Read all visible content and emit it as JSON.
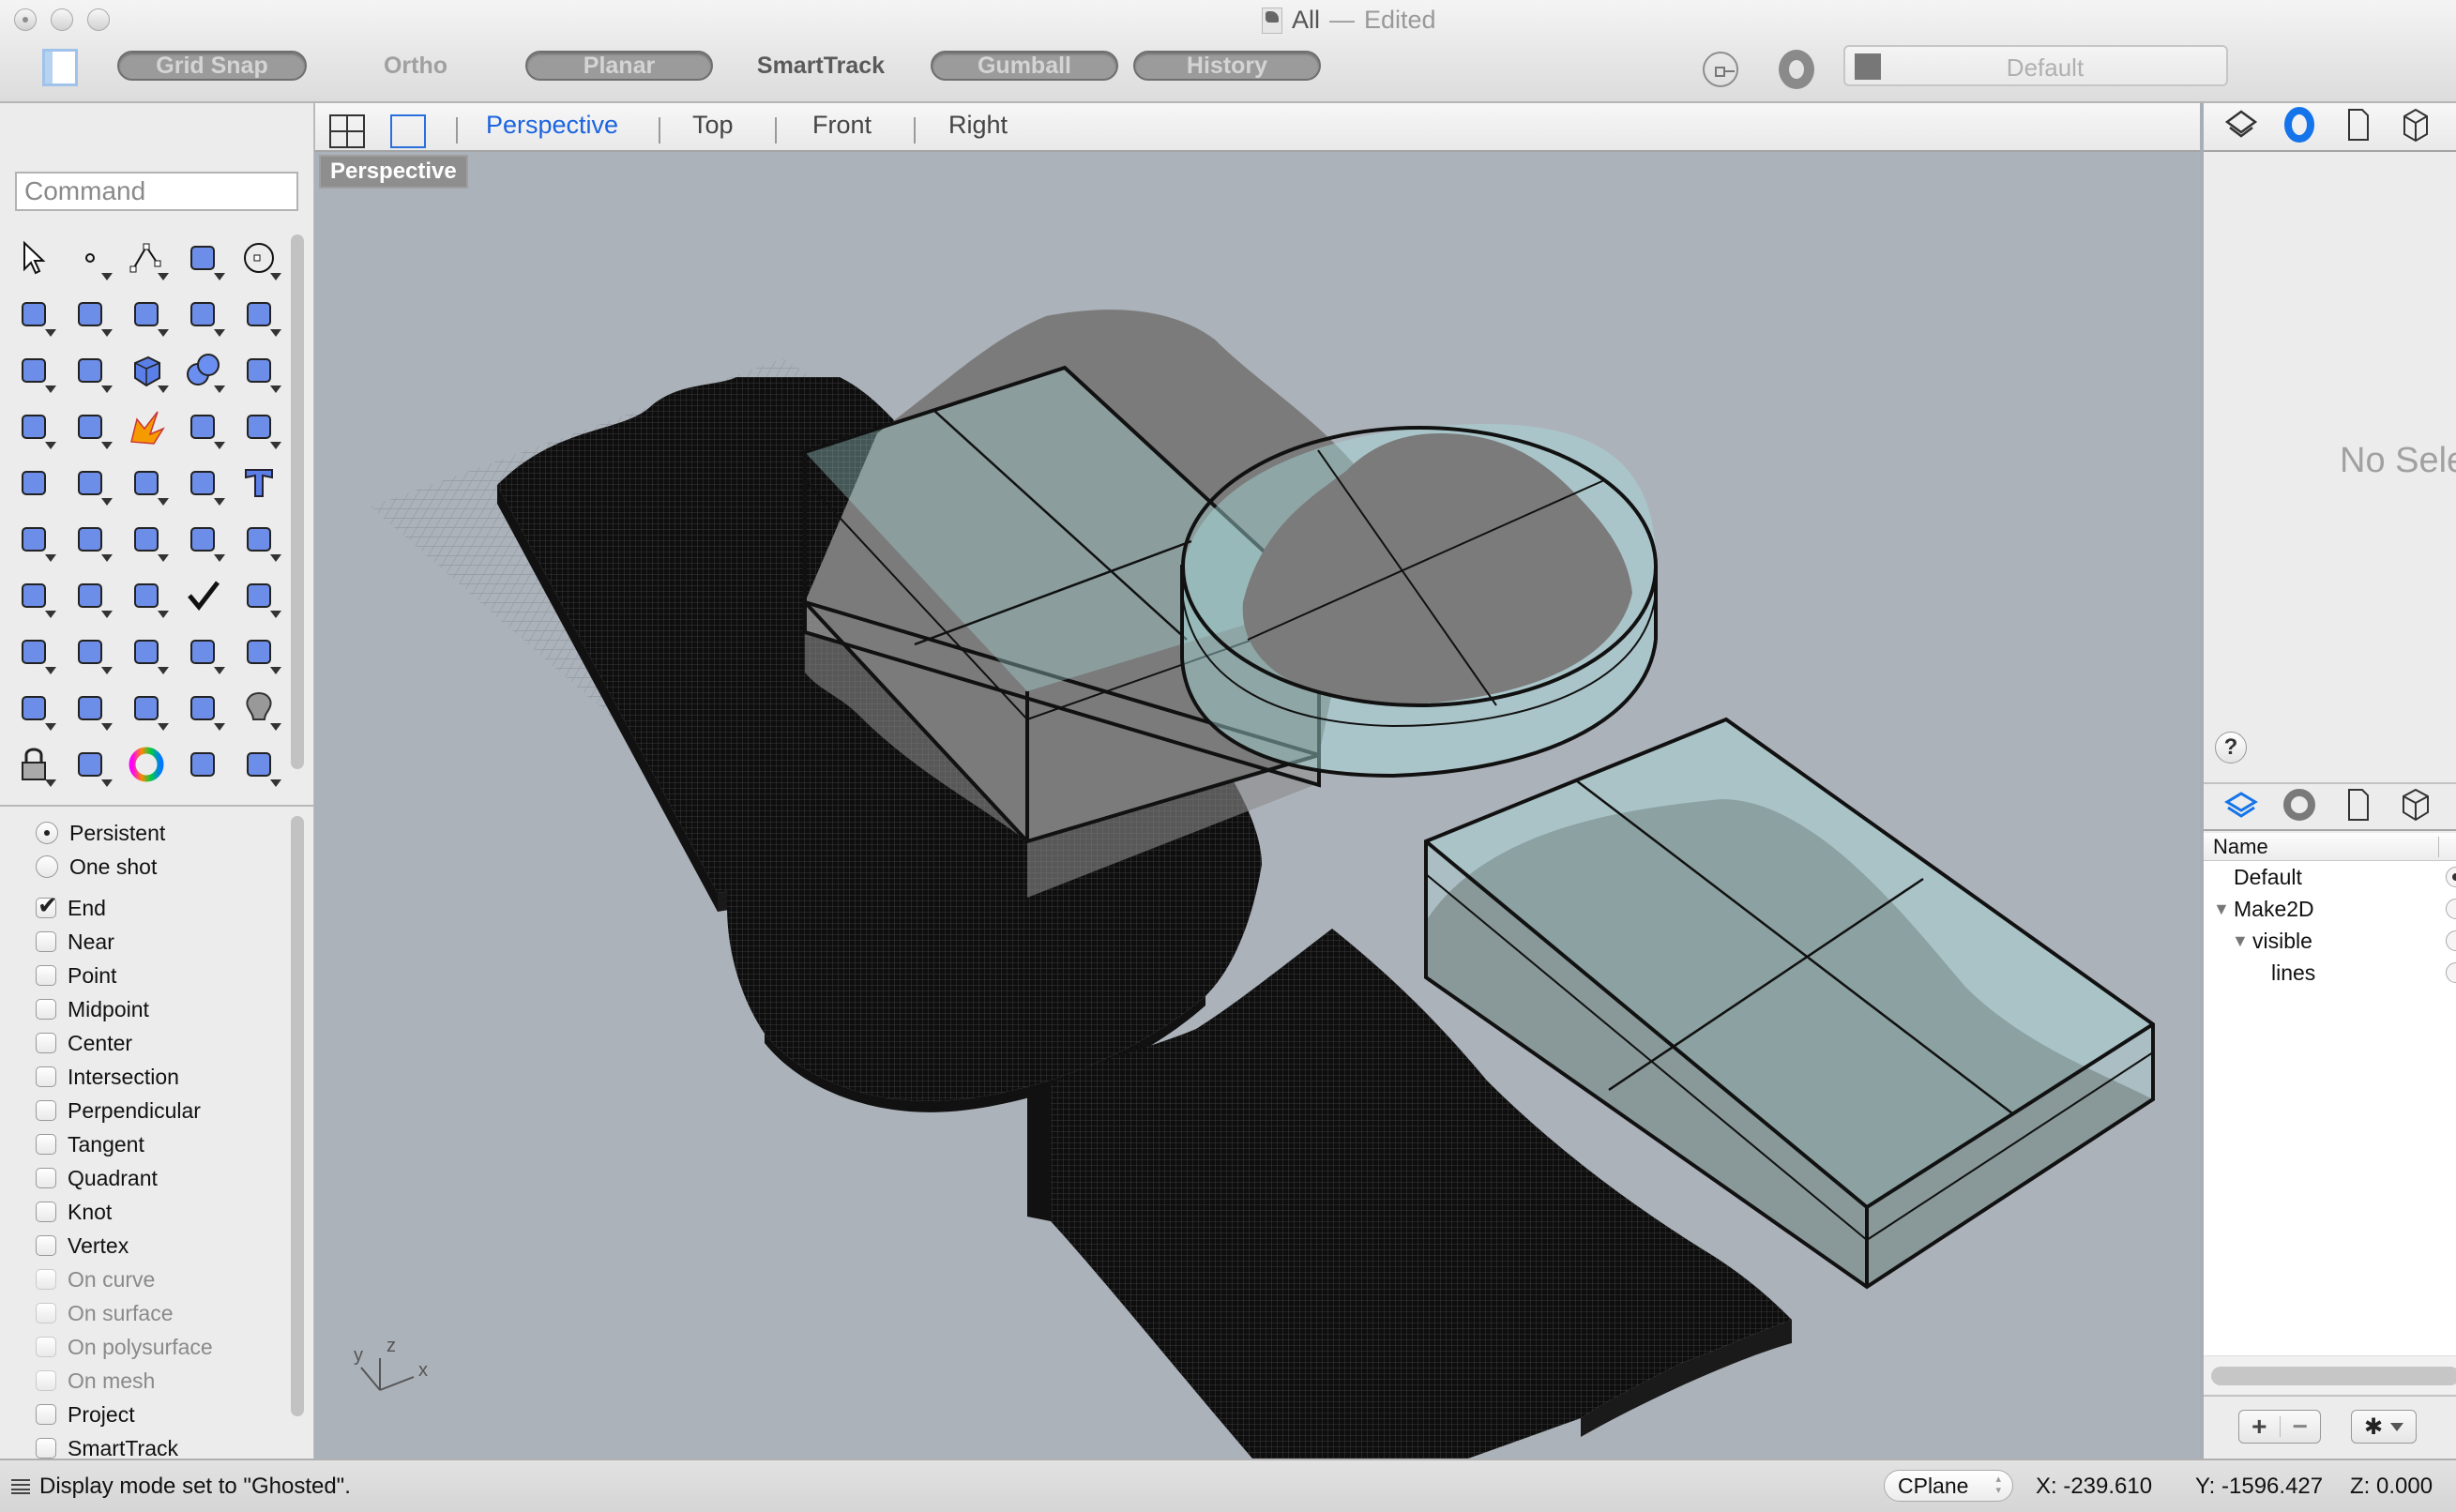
{
  "window": {
    "title": "All",
    "title_separator": " — ",
    "title_status": "Edited"
  },
  "toolbar": {
    "toggles": [
      {
        "label": "Grid Snap",
        "state": "off-pill"
      },
      {
        "label": "Ortho",
        "state": "off"
      },
      {
        "label": "Planar",
        "state": "off-pill"
      },
      {
        "label": "SmartTrack",
        "state": "on"
      },
      {
        "label": "Gumball",
        "state": "off-pill"
      },
      {
        "label": "History",
        "state": "off-pill"
      }
    ],
    "layer_select": "Default"
  },
  "viewport_tabs": {
    "tabs": [
      "Perspective",
      "Top",
      "Front",
      "Right"
    ],
    "active": "Perspective"
  },
  "viewport": {
    "label": "Perspective",
    "axis_labels": {
      "x": "x",
      "y": "y",
      "z": "z"
    },
    "colors": {
      "background": "#acb2ba",
      "glass": "#a8dcdc",
      "mesh": "#111111",
      "terrain_fill": "#7b7b7b",
      "grid": "#8f959d"
    }
  },
  "left_panel": {
    "command_placeholder": "Command",
    "tools": [
      "select-arrow",
      "point",
      "polyline",
      "curve",
      "circle",
      "ellipse",
      "arc",
      "rectangle",
      "polygon",
      "fillet-curve",
      "surface-from-points",
      "extrude-surface",
      "box",
      "sphere",
      "cylinder-pipe",
      "deform-surface",
      "puzzle-join",
      "explode",
      "trim",
      "split",
      "group",
      "ungroup",
      "offset",
      "offset-curve",
      "text",
      "move",
      "copy",
      "rotate",
      "boolean-solid",
      "extrude-up",
      "array",
      "mirror-align",
      "solid-tools",
      "check",
      "primitives",
      "render-pyramid",
      "zoom-in-out",
      "zoom-window",
      "zoom-extents",
      "zoom-selected",
      "rotate-view",
      "car-named-view",
      "cplane-grid",
      "shapes-layers",
      "lightbulb",
      "lock",
      "layer-materials",
      "color-wheel",
      "sphere-display",
      "sphere-grid"
    ],
    "osnap_modes": [
      {
        "label": "Persistent",
        "type": "radio",
        "checked": true
      },
      {
        "label": "One shot",
        "type": "radio",
        "checked": false
      }
    ],
    "osnaps": [
      {
        "label": "End",
        "checked": true,
        "enabled": true
      },
      {
        "label": "Near",
        "checked": false,
        "enabled": true
      },
      {
        "label": "Point",
        "checked": false,
        "enabled": true
      },
      {
        "label": "Midpoint",
        "checked": false,
        "enabled": true
      },
      {
        "label": "Center",
        "checked": false,
        "enabled": true
      },
      {
        "label": "Intersection",
        "checked": false,
        "enabled": true
      },
      {
        "label": "Perpendicular",
        "checked": false,
        "enabled": true
      },
      {
        "label": "Tangent",
        "checked": false,
        "enabled": true
      },
      {
        "label": "Quadrant",
        "checked": false,
        "enabled": true
      },
      {
        "label": "Knot",
        "checked": false,
        "enabled": true
      },
      {
        "label": "Vertex",
        "checked": false,
        "enabled": true
      },
      {
        "label": "On curve",
        "checked": false,
        "enabled": false
      },
      {
        "label": "On surface",
        "checked": false,
        "enabled": false
      },
      {
        "label": "On polysurface",
        "checked": false,
        "enabled": false
      },
      {
        "label": "On mesh",
        "checked": false,
        "enabled": false
      },
      {
        "label": "Project",
        "checked": false,
        "enabled": true
      },
      {
        "label": "SmartTrack",
        "checked": false,
        "enabled": true
      }
    ]
  },
  "right_panel": {
    "properties_empty": "No Selection",
    "help_label": "?",
    "layers_header": "Name",
    "layers": [
      {
        "name": "Default",
        "depth": 0,
        "expanded": null,
        "current": true
      },
      {
        "name": "Make2D",
        "depth": 0,
        "expanded": true,
        "current": false
      },
      {
        "name": "visible",
        "depth": 1,
        "expanded": true,
        "current": false
      },
      {
        "name": "lines",
        "depth": 2,
        "expanded": null,
        "current": false
      }
    ],
    "add_label": "+",
    "remove_label": "−"
  },
  "status_bar": {
    "message": "Display mode set to \"Ghosted\".",
    "cplane": "CPlane",
    "x": "X: -239.610",
    "y": "Y: -1596.427",
    "z": "Z: 0.000"
  }
}
